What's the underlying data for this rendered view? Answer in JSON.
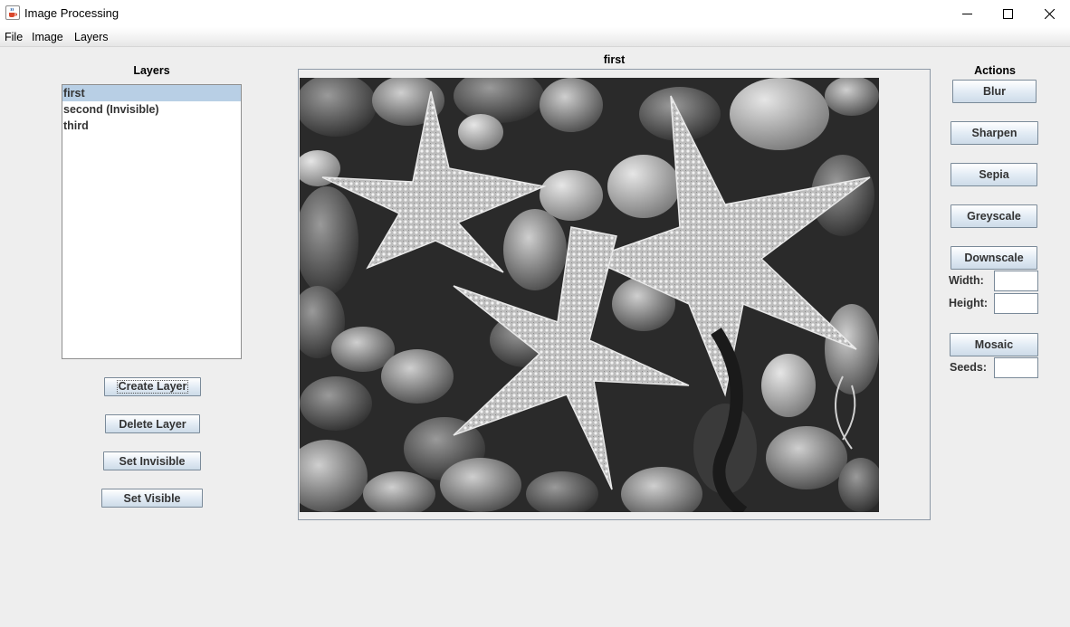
{
  "window": {
    "title": "Image Processing",
    "icons": {
      "app": "java-cup-icon",
      "minimize": "minimize-icon",
      "maximize": "maximize-icon",
      "close": "close-icon"
    }
  },
  "menu": {
    "file": "File",
    "image": "Image",
    "layers": "Layers"
  },
  "layers_panel": {
    "heading": "Layers",
    "items": [
      {
        "label": "first",
        "selected": true
      },
      {
        "label": "second (Invisible)",
        "selected": false
      },
      {
        "label": "third",
        "selected": false
      }
    ],
    "buttons": {
      "create": "Create Layer",
      "delete": "Delete Layer",
      "set_invisible": "Set Invisible",
      "set_visible": "Set Visible"
    }
  },
  "canvas": {
    "heading": "first",
    "image_description": "starfish-on-pebbles-greyscale"
  },
  "actions": {
    "heading": "Actions",
    "blur": "Blur",
    "sharpen": "Sharpen",
    "sepia": "Sepia",
    "greyscale": "Greyscale",
    "downscale": "Downscale",
    "width_label": "Width:",
    "width_value": "",
    "height_label": "Height:",
    "height_value": "",
    "mosaic": "Mosaic",
    "seeds_label": "Seeds:",
    "seeds_value": ""
  },
  "colors": {
    "window_bg": "#eeeeee",
    "selection": "#b8cfe5",
    "button_border": "#7a8a99"
  }
}
